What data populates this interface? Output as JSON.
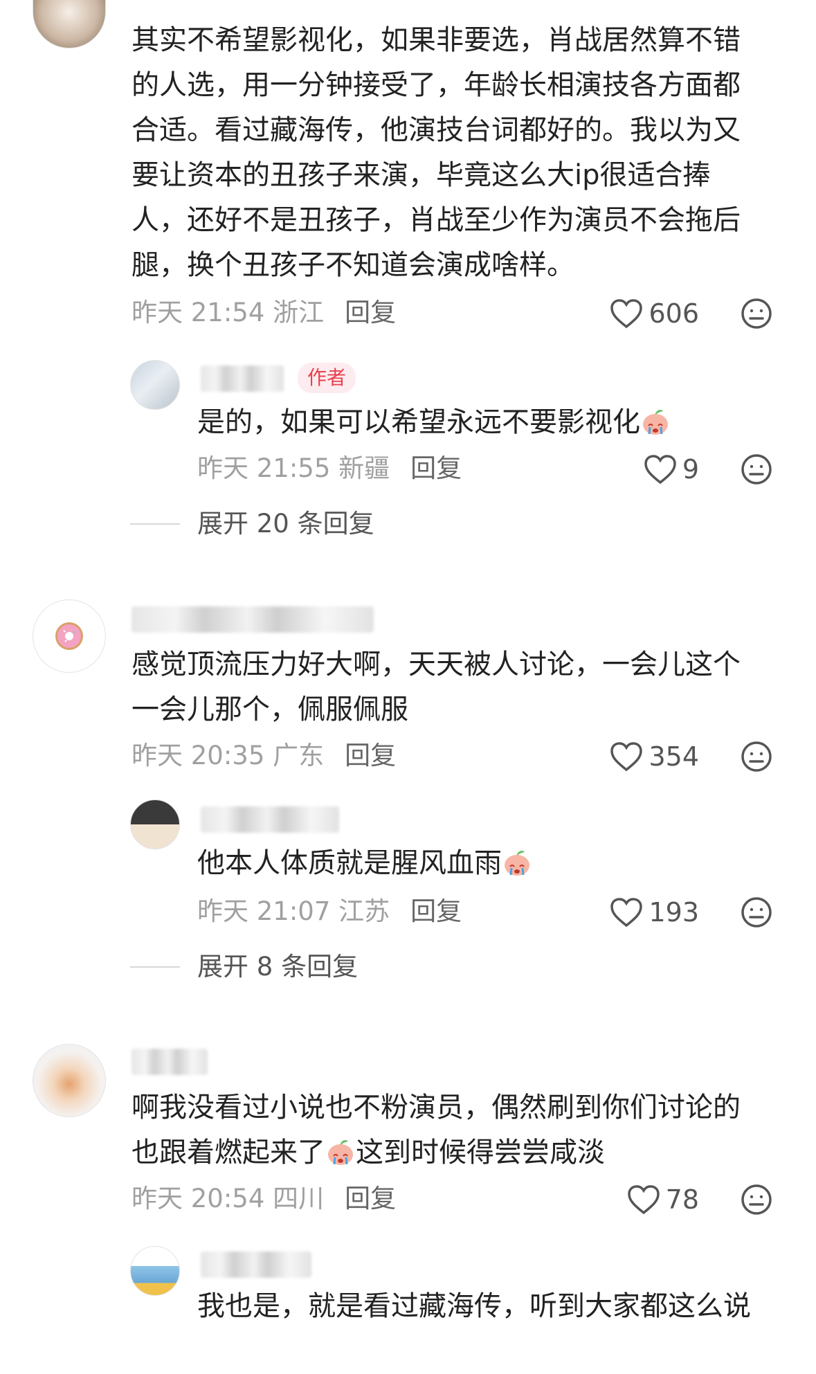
{
  "comments": [
    {
      "lines": [
        "其实不希望影视化，如果非要选，肖战居然算不错",
        "的人选，用一分钟接受了，年龄长相演技各方面都",
        "合适。看过藏海传，他演技台词都好的。我以为又",
        "要让资本的丑孩子来演，毕竟这么大ip很适合捧",
        "人，还好不是丑孩子，肖战至少作为演员不会拖后",
        "腿，换个丑孩子不知道会演成啥样。"
      ],
      "meta": "昨天 21:54 浙江",
      "reply": "回复",
      "likes": "606",
      "sub": {
        "badge": "作者",
        "text": "是的，如果可以希望永远不要影视化",
        "meta": "昨天 21:55 新疆",
        "reply": "回复",
        "likes": "9"
      },
      "expand": "展开 20 条回复"
    },
    {
      "lines": [
        "感觉顶流压力好大啊，天天被人讨论，一会儿这个",
        "一会儿那个，佩服佩服"
      ],
      "meta": "昨天 20:35 广东",
      "reply": "回复",
      "likes": "354",
      "sub": {
        "text": "他本人体质就是腥风血雨",
        "meta": "昨天 21:07 江苏",
        "reply": "回复",
        "likes": "193"
      },
      "expand": "展开 8 条回复"
    },
    {
      "lines": [
        "啊我没看过小说也不粉演员，偶然刷到你们讨论的",
        "也跟着燃起来了"
      ],
      "line2_suffix": "这到时候得尝尝咸淡",
      "meta": "昨天 20:54 四川",
      "reply": "回复",
      "likes": "78",
      "sub": {
        "text": "我也是，就是看过藏海传，听到大家都这么说"
      }
    }
  ],
  "icons": {
    "like": "heart-outline-icon",
    "react": "neutral-face-icon",
    "emoji": "crying-peach-emoji"
  }
}
